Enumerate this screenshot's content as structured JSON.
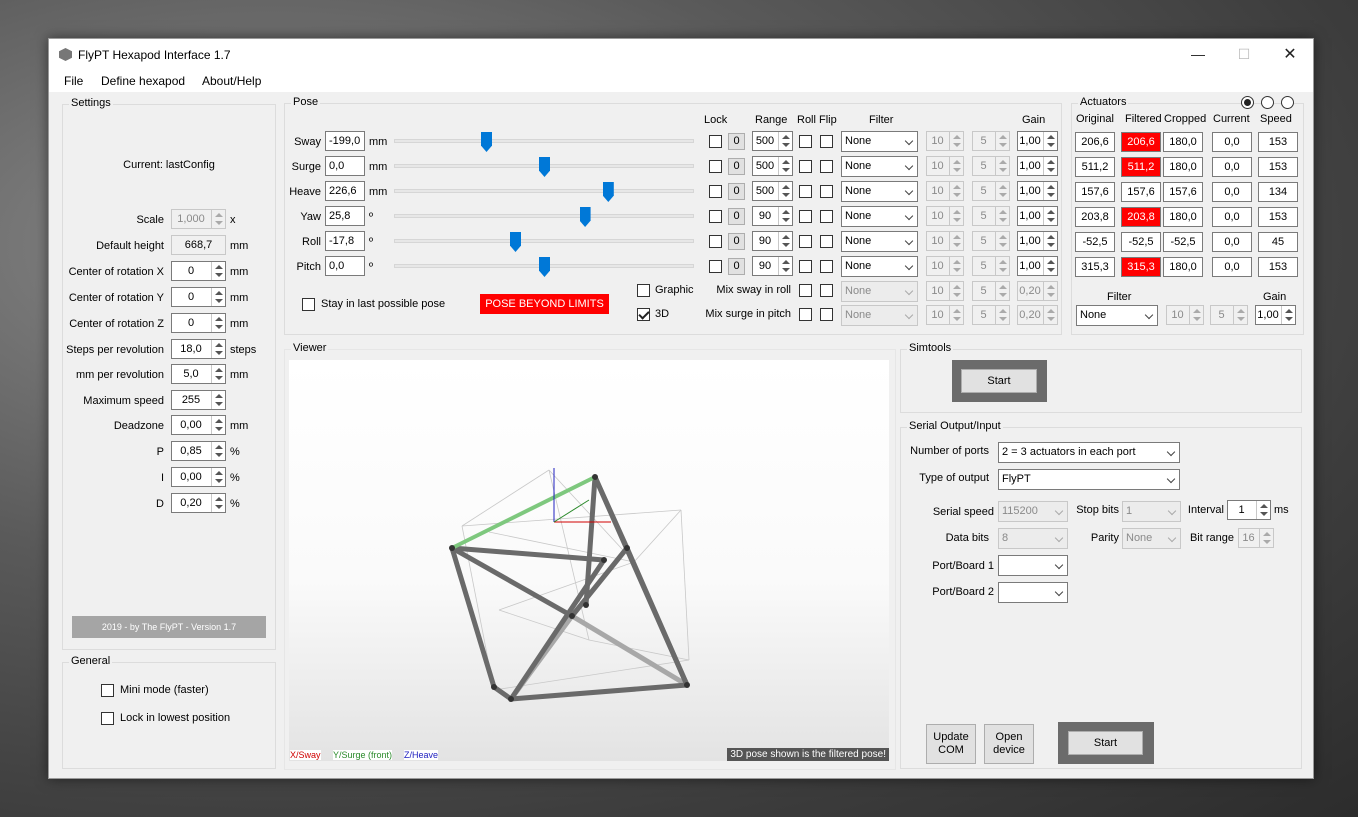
{
  "window": {
    "title": "FlyPT Hexapod Interface 1.7"
  },
  "menu": [
    "File",
    "Define hexapod",
    "About/Help"
  ],
  "settings": {
    "title": "Settings",
    "current": "Current: lastConfig",
    "scale": {
      "label": "Scale",
      "value": "1,000",
      "unit": "x"
    },
    "default_height": {
      "label": "Default height",
      "value": "668,7",
      "unit": "mm"
    },
    "cor_x": {
      "label": "Center of rotation X",
      "value": "0",
      "unit": "mm"
    },
    "cor_y": {
      "label": "Center of rotation Y",
      "value": "0",
      "unit": "mm"
    },
    "cor_z": {
      "label": "Center of rotation Z",
      "value": "0",
      "unit": "mm"
    },
    "steps_rev": {
      "label": "Steps per revolution",
      "value": "18,0",
      "unit": "steps"
    },
    "mm_rev": {
      "label": "mm per revolution",
      "value": "5,0",
      "unit": "mm"
    },
    "max_speed": {
      "label": "Maximum speed",
      "value": "255",
      "unit": ""
    },
    "deadzone": {
      "label": "Deadzone",
      "value": "0,00",
      "unit": "mm"
    },
    "p": {
      "label": "P",
      "value": "0,85",
      "unit": "%"
    },
    "i": {
      "label": "I",
      "value": "0,00",
      "unit": "%"
    },
    "d": {
      "label": "D",
      "value": "0,20",
      "unit": "%"
    },
    "footer": "2019 - by The FlyPT - Version 1.7"
  },
  "general": {
    "title": "General",
    "mini_mode": "Mini mode (faster)",
    "lock_lowest": "Lock in lowest position"
  },
  "pose": {
    "title": "Pose",
    "headers": {
      "lock": "Lock",
      "range": "Range",
      "roll": "Roll",
      "flip": "Flip",
      "filter": "Filter",
      "gain": "Gain"
    },
    "rows": [
      {
        "label": "Sway",
        "value": "-199,0",
        "unit": "mm",
        "slider": 0.3,
        "lock": "0",
        "range": "500",
        "filter": "None",
        "f1": "10",
        "f2": "5",
        "gain": "1,00"
      },
      {
        "label": "Surge",
        "value": "0,0",
        "unit": "mm",
        "slider": 0.5,
        "lock": "0",
        "range": "500",
        "filter": "None",
        "f1": "10",
        "f2": "5",
        "gain": "1,00"
      },
      {
        "label": "Heave",
        "value": "226,6",
        "unit": "mm",
        "slider": 0.72,
        "lock": "0",
        "range": "500",
        "filter": "None",
        "f1": "10",
        "f2": "5",
        "gain": "1,00"
      },
      {
        "label": "Yaw",
        "value": "25,8",
        "unit": "º",
        "slider": 0.64,
        "lock": "0",
        "range": "90",
        "filter": "None",
        "f1": "10",
        "f2": "5",
        "gain": "1,00"
      },
      {
        "label": "Roll",
        "value": "-17,8",
        "unit": "º",
        "slider": 0.4,
        "lock": "0",
        "range": "90",
        "filter": "None",
        "f1": "10",
        "f2": "5",
        "gain": "1,00"
      },
      {
        "label": "Pitch",
        "value": "0,0",
        "unit": "º",
        "slider": 0.5,
        "lock": "0",
        "range": "90",
        "filter": "None",
        "f1": "10",
        "f2": "5",
        "gain": "1,00"
      }
    ],
    "stay_last": "Stay in last possible pose",
    "beyond": "POSE BEYOND LIMITS",
    "graphic": "Graphic",
    "three_d": "3D",
    "mix_sway": {
      "label": "Mix sway in roll",
      "filter": "None",
      "f1": "10",
      "f2": "5",
      "gain": "0,20"
    },
    "mix_surge": {
      "label": "Mix surge in pitch",
      "filter": "None",
      "f1": "10",
      "f2": "5",
      "gain": "0,20"
    }
  },
  "actuators": {
    "title": "Actuators",
    "headers": [
      "Original",
      "Filtered",
      "Cropped",
      "Current",
      "Speed"
    ],
    "rows": [
      {
        "original": "206,6",
        "filtered": "206,6",
        "cropped": "180,0",
        "current": "0,0",
        "speed": "153",
        "red": true
      },
      {
        "original": "511,2",
        "filtered": "511,2",
        "cropped": "180,0",
        "current": "0,0",
        "speed": "153",
        "red": true
      },
      {
        "original": "157,6",
        "filtered": "157,6",
        "cropped": "157,6",
        "current": "0,0",
        "speed": "134",
        "red": false
      },
      {
        "original": "203,8",
        "filtered": "203,8",
        "cropped": "180,0",
        "current": "0,0",
        "speed": "153",
        "red": true
      },
      {
        "original": "-52,5",
        "filtered": "-52,5",
        "cropped": "-52,5",
        "current": "0,0",
        "speed": "45",
        "red": false
      },
      {
        "original": "315,3",
        "filtered": "315,3",
        "cropped": "180,0",
        "current": "0,0",
        "speed": "153",
        "red": true
      }
    ],
    "filter_label": "Filter",
    "gain_label": "Gain",
    "filter": "None",
    "f1": "10",
    "f2": "5",
    "gain": "1,00"
  },
  "viewer": {
    "title": "Viewer",
    "legend_x": "X/Sway",
    "legend_y": "Y/Surge (front)",
    "legend_z": "Z/Heave",
    "note": "3D pose shown is the filtered pose!"
  },
  "simtools": {
    "title": "Simtools",
    "start": "Start"
  },
  "serial": {
    "title": "Serial Output/Input",
    "ports_label": "Number of ports",
    "ports_value": "2 = 3 actuators in each port",
    "output_label": "Type of output",
    "output_value": "FlyPT",
    "speed_label": "Serial speed",
    "speed_value": "115200",
    "stop_label": "Stop bits",
    "stop_value": "1",
    "interval_label": "Interval",
    "interval_value": "1",
    "interval_unit": "ms",
    "data_label": "Data bits",
    "data_value": "8",
    "parity_label": "Parity",
    "parity_value": "None",
    "bitrange_label": "Bit range",
    "bitrange_value": "16",
    "port1_label": "Port/Board 1",
    "port2_label": "Port/Board 2",
    "update_com": "Update COM",
    "open_device": "Open device",
    "start": "Start"
  },
  "colors": {
    "accent": "#0078d7",
    "alert": "#ff0000",
    "x_axis": "#d00000",
    "y_axis": "#2a8a2a",
    "z_axis": "#2020c0"
  }
}
